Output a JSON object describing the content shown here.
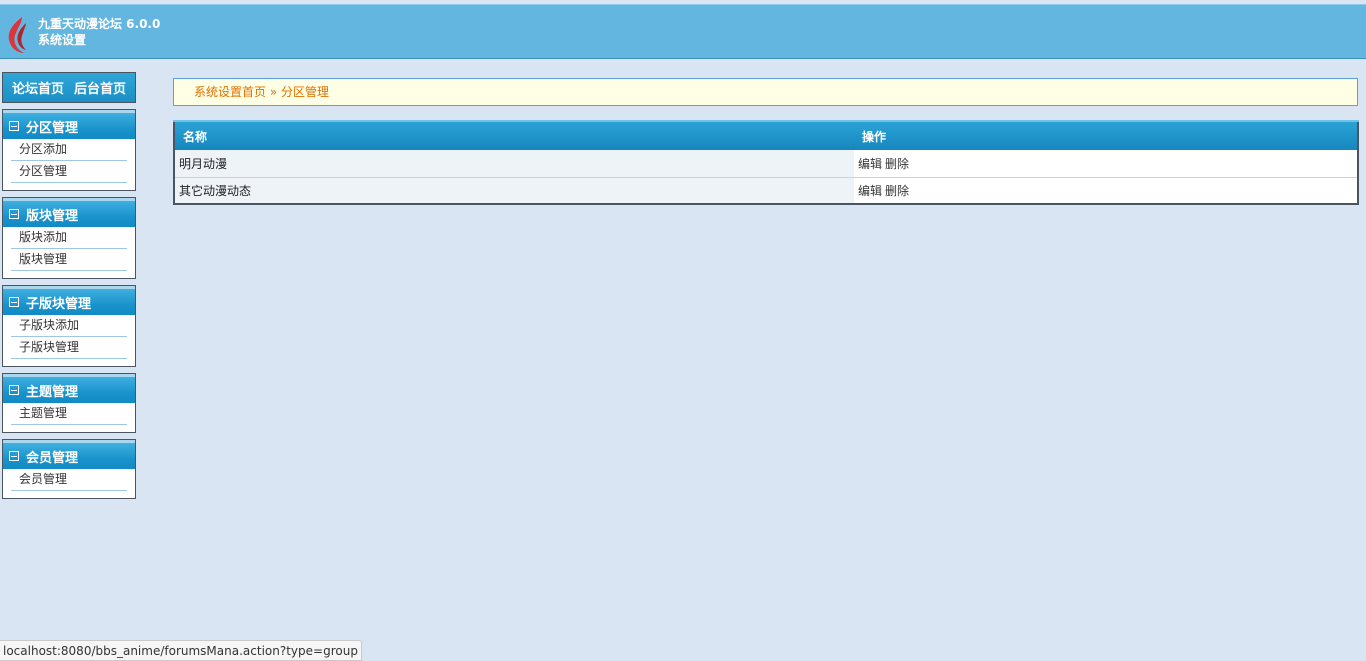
{
  "header": {
    "title": "九重天动漫论坛 6.0.0",
    "subtitle": "系统设置",
    "logo": "flame-logo"
  },
  "sidebar": {
    "home_links": [
      "论坛首页",
      "后台首页"
    ],
    "groups": [
      {
        "title": "分区管理",
        "items": [
          "分区添加",
          "分区管理"
        ]
      },
      {
        "title": "版块管理",
        "items": [
          "版块添加",
          "版块管理"
        ]
      },
      {
        "title": "子版块管理",
        "items": [
          "子版块添加",
          "子版块管理"
        ]
      },
      {
        "title": "主题管理",
        "items": [
          "主题管理"
        ]
      },
      {
        "title": "会员管理",
        "items": [
          "会员管理"
        ]
      }
    ]
  },
  "breadcrumb": {
    "home": "系统设置首页",
    "separator": "»",
    "current": "分区管理"
  },
  "table": {
    "columns": [
      "名称",
      "操作"
    ],
    "rows": [
      {
        "name": "明月动漫",
        "edit": "编辑",
        "delete": "删除"
      },
      {
        "name": "其它动漫动态",
        "edit": "编辑",
        "delete": "删除"
      }
    ]
  },
  "status_bar": {
    "url": "localhost:8080/bbs_anime/forumsMana.action?type=group"
  },
  "colors": {
    "header_bg": "#62b6df",
    "page_bg": "#dae5f3",
    "accent_blue": "#1a93cc",
    "breadcrumb_text": "#e07000",
    "breadcrumb_bg": "#ffffe6"
  }
}
